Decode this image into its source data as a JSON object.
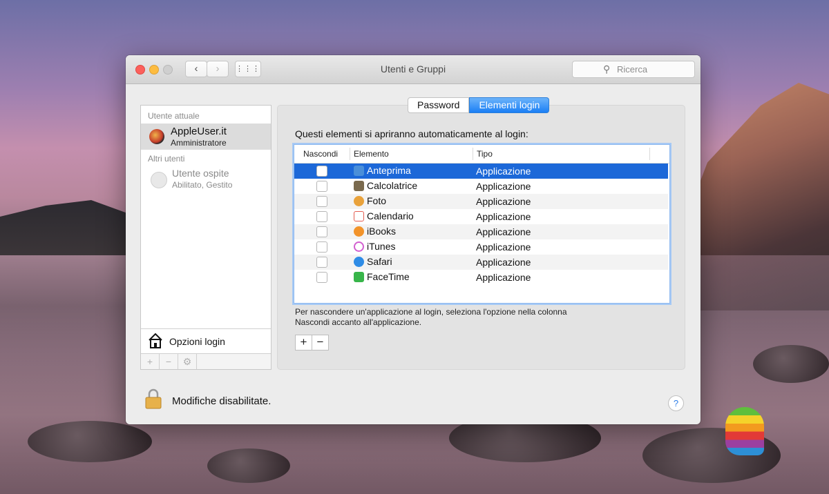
{
  "window": {
    "title": "Utenti e Gruppi",
    "search_placeholder": "Ricerca",
    "nav_back": "‹",
    "nav_forward": "›",
    "grid_button": "⋮⋮⋮"
  },
  "sidebar": {
    "current_header": "Utente attuale",
    "current_user": {
      "name": "AppleUser.it",
      "role": "Amministratore"
    },
    "other_header": "Altri utenti",
    "guest_user": {
      "name": "Utente ospite",
      "status": "Abilitato, Gestito"
    },
    "login_options_label": "Opzioni login",
    "add_label": "+",
    "remove_label": "−",
    "gear_label": "⚙"
  },
  "tabs": [
    {
      "label": "Password",
      "active": false
    },
    {
      "label": "Elementi login",
      "active": true
    }
  ],
  "login_items": {
    "intro": "Questi elementi si apriranno automaticamente al login:",
    "columns": [
      "Nascondi",
      "Elemento",
      "Tipo"
    ],
    "rows": [
      {
        "hide": false,
        "name": "Anteprima",
        "type": "Applicazione",
        "icon": "preview-icon",
        "color": "#4a8fd9",
        "selected": true
      },
      {
        "hide": false,
        "name": "Calcolatrice",
        "type": "Applicazione",
        "icon": "calculator-icon",
        "color": "#7a6a4e",
        "selected": false
      },
      {
        "hide": false,
        "name": "Foto",
        "type": "Applicazione",
        "icon": "photos-icon",
        "color": "#e9a23b",
        "selected": false
      },
      {
        "hide": false,
        "name": "Calendario",
        "type": "Applicazione",
        "icon": "calendar-icon",
        "color": "#e45b4f",
        "selected": false
      },
      {
        "hide": false,
        "name": "iBooks",
        "type": "Applicazione",
        "icon": "ibooks-icon",
        "color": "#f2932a",
        "selected": false
      },
      {
        "hide": false,
        "name": "iTunes",
        "type": "Applicazione",
        "icon": "itunes-icon",
        "color": "#d25fd0",
        "selected": false
      },
      {
        "hide": false,
        "name": "Safari",
        "type": "Applicazione",
        "icon": "safari-icon",
        "color": "#2f8ce6",
        "selected": false
      },
      {
        "hide": false,
        "name": "FaceTime",
        "type": "Applicazione",
        "icon": "facetime-icon",
        "color": "#38b54a",
        "selected": false
      }
    ],
    "hint": "Per nascondere un'applicazione al login, seleziona l'opzione nella colonna Nascondi accanto all'applicazione.",
    "add_label": "+",
    "remove_label": "−"
  },
  "footer": {
    "lock_text": "Modifiche disabilitate.",
    "help_label": "?"
  },
  "colors": {
    "selection": "#1c68d8",
    "tab_active": "#1b7ff5"
  }
}
